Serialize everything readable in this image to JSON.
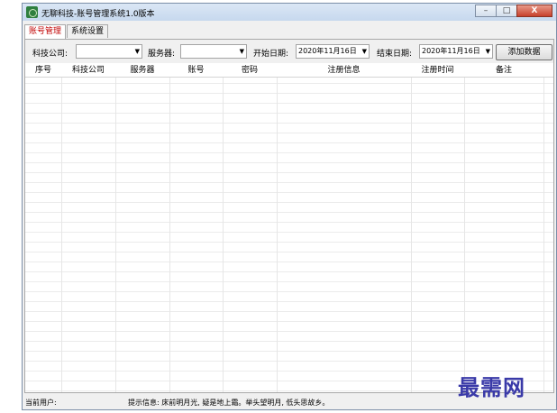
{
  "window": {
    "title": "无聊科技-账号管理系统1.0版本",
    "buttons": {
      "minimize": "–",
      "maximize": "□",
      "close": "X"
    }
  },
  "tabs": [
    {
      "label": "账号管理",
      "active": true
    },
    {
      "label": "系统设置",
      "active": false
    }
  ],
  "filters": {
    "company_label": "科技公司:",
    "company_value": "",
    "server_label": "服务器:",
    "server_value": "",
    "start_date_label": "开始日期:",
    "start_date_value": "2020年11月16日",
    "end_date_label": "结束日期:",
    "end_date_value": "2020年11月16日",
    "add_button": "添加数据"
  },
  "table": {
    "columns": [
      "序号",
      "科技公司",
      "服务器",
      "账号",
      "密码",
      "注册信息",
      "注册时间",
      "备注"
    ],
    "rows": []
  },
  "status": {
    "current_user_label": "当前用户:",
    "tip": "提示信息: 床前明月光, 疑是地上霜。举头望明月, 低头思故乡。"
  },
  "watermark": "最需网",
  "colors": {
    "active_tab_text": "#c00000",
    "watermark": "#3a3aa8",
    "close_button": "#c7402c"
  }
}
